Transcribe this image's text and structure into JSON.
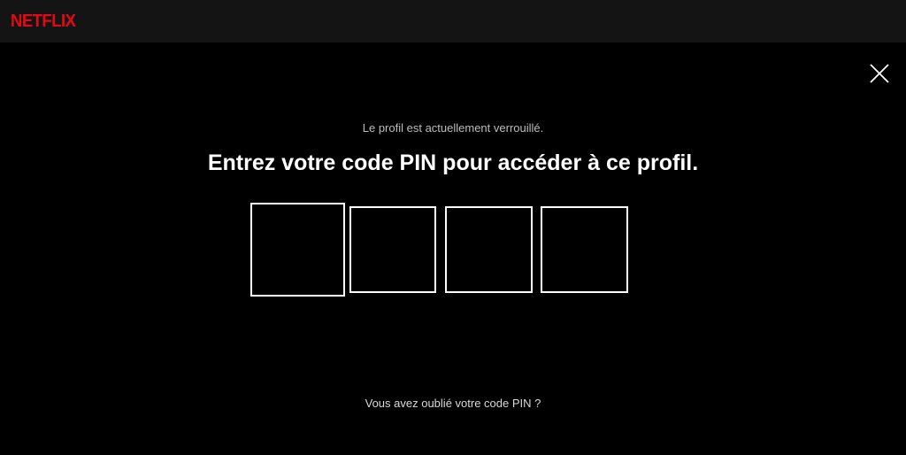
{
  "header": {
    "logo_text": "NETFLIX",
    "brand_color": "#e50914"
  },
  "close": {
    "icon": "close-icon"
  },
  "lock_screen": {
    "subtitle": "Le profil est actuellement verrouillé.",
    "title": "Entrez votre code PIN pour accéder à ce profil.",
    "pin_digits": [
      "",
      "",
      "",
      ""
    ],
    "forgot_link": "Vous avez oublié votre code PIN ?"
  }
}
